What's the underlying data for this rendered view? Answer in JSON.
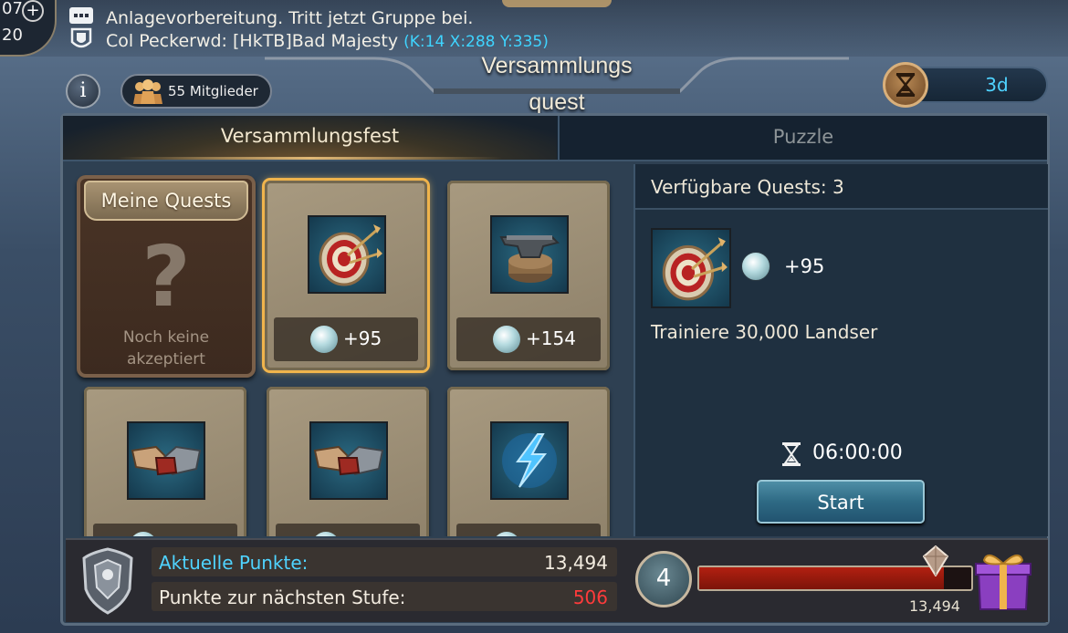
{
  "topbar": {
    "resource_top": "07",
    "resource_bottom": "20",
    "plus_glyph": "+",
    "chat_line1": "Anlagevorbereitung. Tritt jetzt Gruppe bei.",
    "chat_line2": "Col Peckerwd: [HkTB]Bad Majesty",
    "chat_coords": "(K:14 X:288 Y:335)"
  },
  "header": {
    "title_line1": "Versammlungs",
    "title_line2": "quest",
    "info_glyph": "i",
    "members": "55 Mitglieder",
    "timer": "3d"
  },
  "tabs": {
    "active": "Versammlungsfest",
    "inactive": "Puzzle"
  },
  "my_quests": {
    "title": "Meine Quests",
    "placeholder_glyph": "?",
    "empty_line1": "Noch keine",
    "empty_line2": "akzeptiert"
  },
  "quests": [
    {
      "icon": "archery-target-icon",
      "reward": "+95"
    },
    {
      "icon": "anvil-icon",
      "reward": "+154"
    },
    {
      "icon": "gauntlet-handshake-icon",
      "reward": ""
    },
    {
      "icon": "gauntlet-handshake-icon",
      "reward": ""
    },
    {
      "icon": "lightning-bolt-icon",
      "reward": ""
    }
  ],
  "detail": {
    "available": "Verfügbare Quests: 3",
    "reward": "+95",
    "description": "Trainiere 30,000 Landser",
    "time": "06:00:00",
    "start_label": "Start"
  },
  "bottom": {
    "current_label": "Aktuelle Punkte:",
    "current_value": "13,494",
    "next_label": "Punkte zur nächsten Stufe:",
    "next_value": "506",
    "level": "4",
    "progress_fraction": 0.9,
    "progress_value": "13,494"
  },
  "colors": {
    "accent_cyan": "#4fd3ff",
    "warning_red": "#ff3b3b",
    "selected_gold": "#f0b44c"
  }
}
